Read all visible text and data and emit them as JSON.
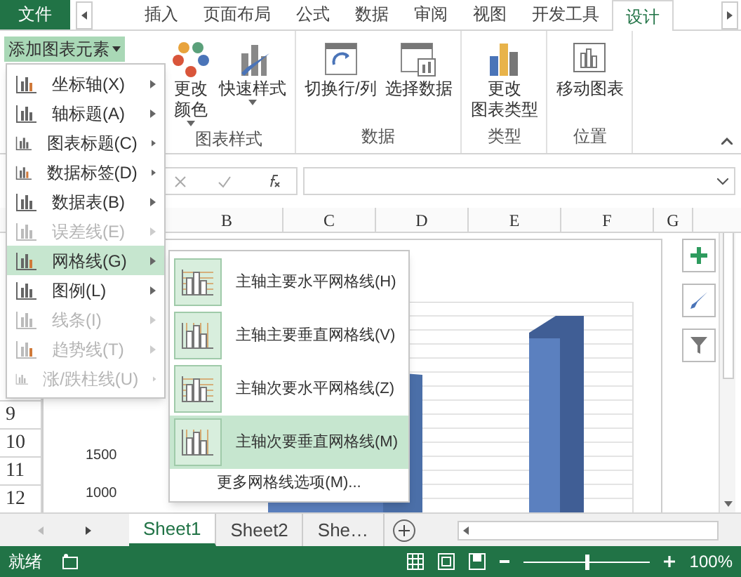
{
  "tabs": [
    {
      "label": "文件",
      "kind": "file",
      "selected": false
    },
    {
      "label": "插入",
      "kind": "tab",
      "selected": false
    },
    {
      "label": "页面布局",
      "kind": "tab",
      "selected": false
    },
    {
      "label": "公式",
      "kind": "tab",
      "selected": false
    },
    {
      "label": "数据",
      "kind": "tab",
      "selected": false
    },
    {
      "label": "审阅",
      "kind": "tab",
      "selected": false
    },
    {
      "label": "视图",
      "kind": "tab",
      "selected": false
    },
    {
      "label": "开发工具",
      "kind": "tab",
      "selected": false
    },
    {
      "label": "设计",
      "kind": "tab",
      "selected": true
    }
  ],
  "ribbon": {
    "add_element": "添加图表元素",
    "groups": [
      {
        "label": "图表样式",
        "buttons": [
          {
            "lines": [
              "更改",
              "颜色"
            ],
            "kind": "colors",
            "dropdown": true
          },
          {
            "lines": [
              "快速样式"
            ],
            "kind": "styles",
            "dropdown": true
          }
        ]
      },
      {
        "label": "数据",
        "buttons": [
          {
            "lines": [
              "切换行/列"
            ],
            "kind": "switch",
            "dropdown": false
          },
          {
            "lines": [
              "选择数据"
            ],
            "kind": "select",
            "dropdown": false
          }
        ]
      },
      {
        "label": "类型",
        "buttons": [
          {
            "lines": [
              "更改",
              "图表类型"
            ],
            "kind": "type",
            "dropdown": false
          }
        ]
      },
      {
        "label": "位置",
        "buttons": [
          {
            "lines": [
              "移动图表"
            ],
            "kind": "move",
            "dropdown": false
          }
        ]
      }
    ]
  },
  "menu": [
    {
      "label": "坐标轴(X)",
      "disabled": false,
      "selected": false
    },
    {
      "label": "轴标题(A)",
      "disabled": false,
      "selected": false
    },
    {
      "label": "图表标题(C)",
      "disabled": false,
      "selected": false
    },
    {
      "label": "数据标签(D)",
      "disabled": false,
      "selected": false
    },
    {
      "label": "数据表(B)",
      "disabled": false,
      "selected": false
    },
    {
      "label": "误差线(E)",
      "disabled": true,
      "selected": false
    },
    {
      "label": "网格线(G)",
      "disabled": false,
      "selected": true
    },
    {
      "label": "图例(L)",
      "disabled": false,
      "selected": false
    },
    {
      "label": "线条(I)",
      "disabled": true,
      "selected": false
    },
    {
      "label": "趋势线(T)",
      "disabled": true,
      "selected": false
    },
    {
      "label": "涨/跌柱线(U)",
      "disabled": true,
      "selected": false
    }
  ],
  "submenu": {
    "items": [
      {
        "label": "主轴主要水平网格线(H)",
        "selected": false
      },
      {
        "label": "主轴主要垂直网格线(V)",
        "selected": false
      },
      {
        "label": "主轴次要水平网格线(Z)",
        "selected": false
      },
      {
        "label": "主轴次要垂直网格线(M)",
        "selected": true
      }
    ],
    "more": "更多网格线选项(M)..."
  },
  "columns": [
    "B",
    "C",
    "D",
    "E",
    "F",
    "G"
  ],
  "rows": [
    "9",
    "10",
    "11",
    "12"
  ],
  "axis_labels": [
    "1500",
    "1000"
  ],
  "sheets": [
    {
      "label": "Sheet1",
      "selected": true
    },
    {
      "label": "Sheet2",
      "selected": false
    },
    {
      "label": "She…",
      "selected": false
    }
  ],
  "status": {
    "text": "就绪",
    "zoom": "100%",
    "level": 0.5
  }
}
